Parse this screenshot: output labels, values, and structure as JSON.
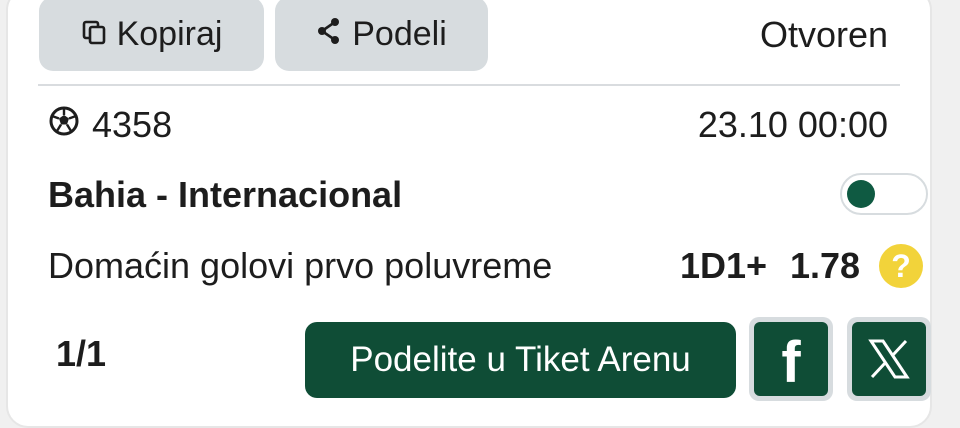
{
  "actions": {
    "copy_label": "Kopiraj",
    "share_label": "Podeli"
  },
  "ticket": {
    "status": "Otvoren",
    "event_id": "4358",
    "datetime": "23.10 00:00",
    "match": "Bahia - Internacional",
    "market": "Domaćin golovi prvo poluvreme",
    "pick": "1D1+",
    "odds": "1.78",
    "help_glyph": "?",
    "pager": "1/1",
    "toggle_on": true
  },
  "footer": {
    "arena_button_label": "Podelite u Tiket Arenu",
    "facebook_glyph": "f"
  },
  "colors": {
    "brand_green": "#0f4d36",
    "toggle_knob": "#0f5a42",
    "help_yellow": "#f2d33a",
    "button_gray": "#d7dcdf"
  },
  "icons": [
    "copy-icon",
    "share-icon",
    "soccer-ball-icon",
    "help-icon",
    "facebook-icon",
    "x-icon"
  ]
}
